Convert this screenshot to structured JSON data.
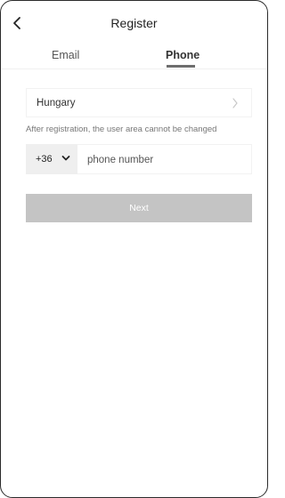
{
  "header": {
    "title": "Register",
    "back_icon": "chevron-left-icon"
  },
  "tabs": [
    {
      "label": "Email",
      "active": false
    },
    {
      "label": "Phone",
      "active": true
    }
  ],
  "country": {
    "name": "Hungary",
    "chevron_icon": "chevron-right-icon"
  },
  "hint": "After registration, the user area cannot be changed",
  "phone": {
    "country_code": "+36",
    "dropdown_icon": "chevron-down-icon",
    "placeholder": "phone number",
    "value": ""
  },
  "next_button": {
    "label": "Next",
    "enabled": false
  },
  "colors": {
    "button_disabled": "#c4c4c4",
    "tab_indicator": "#6e6e6e",
    "code_background": "#efefef"
  }
}
